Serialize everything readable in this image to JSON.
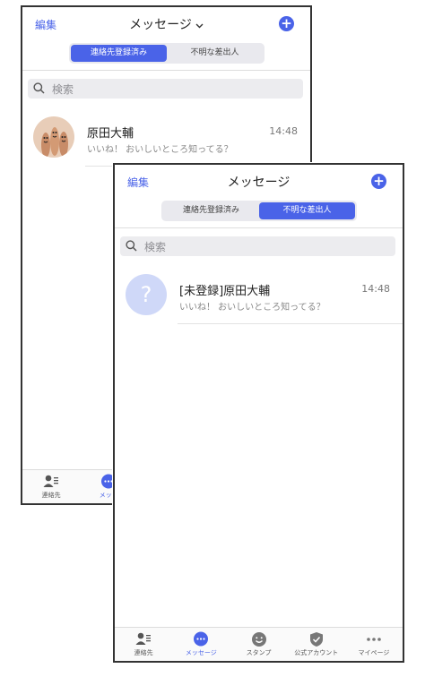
{
  "back_screen": {
    "header": {
      "edit_label": "編集",
      "title": "メッセージ",
      "chevron": "⌵"
    },
    "segments": [
      {
        "label": "連絡先登録済み",
        "active": true
      },
      {
        "label": "不明な差出人",
        "active": false
      }
    ],
    "search": {
      "placeholder": "検索"
    },
    "conversation": {
      "name": "原田大輔",
      "preview": "いいね！ おいしいところ知ってる？",
      "time": "14:48"
    },
    "tabs": [
      {
        "label": "連絡先",
        "icon": "contacts-icon",
        "active": false
      },
      {
        "label": "メッセ",
        "icon": "message-icon",
        "active": true
      }
    ]
  },
  "front_screen": {
    "header": {
      "edit_label": "編集",
      "title": "メッセージ"
    },
    "segments": [
      {
        "label": "連絡先登録済み",
        "active": false
      },
      {
        "label": "不明な差出人",
        "active": true
      }
    ],
    "search": {
      "placeholder": "検索"
    },
    "conversation": {
      "name": "[未登録]原田大輔",
      "preview": "いいね！ おいしいところ知ってる？",
      "time": "14:48",
      "avatar_glyph": "?"
    },
    "tabs": [
      {
        "label": "連絡先",
        "icon": "contacts-icon",
        "active": false
      },
      {
        "label": "メッセージ",
        "icon": "message-icon",
        "active": true
      },
      {
        "label": "スタンプ",
        "icon": "sticker-icon",
        "active": false
      },
      {
        "label": "公式アカウント",
        "icon": "shield-icon",
        "active": false
      },
      {
        "label": "マイページ",
        "icon": "more-icon",
        "active": false
      }
    ]
  },
  "colors": {
    "accent": "#4a63e8",
    "unknown_avatar": "#cfd8f8"
  }
}
